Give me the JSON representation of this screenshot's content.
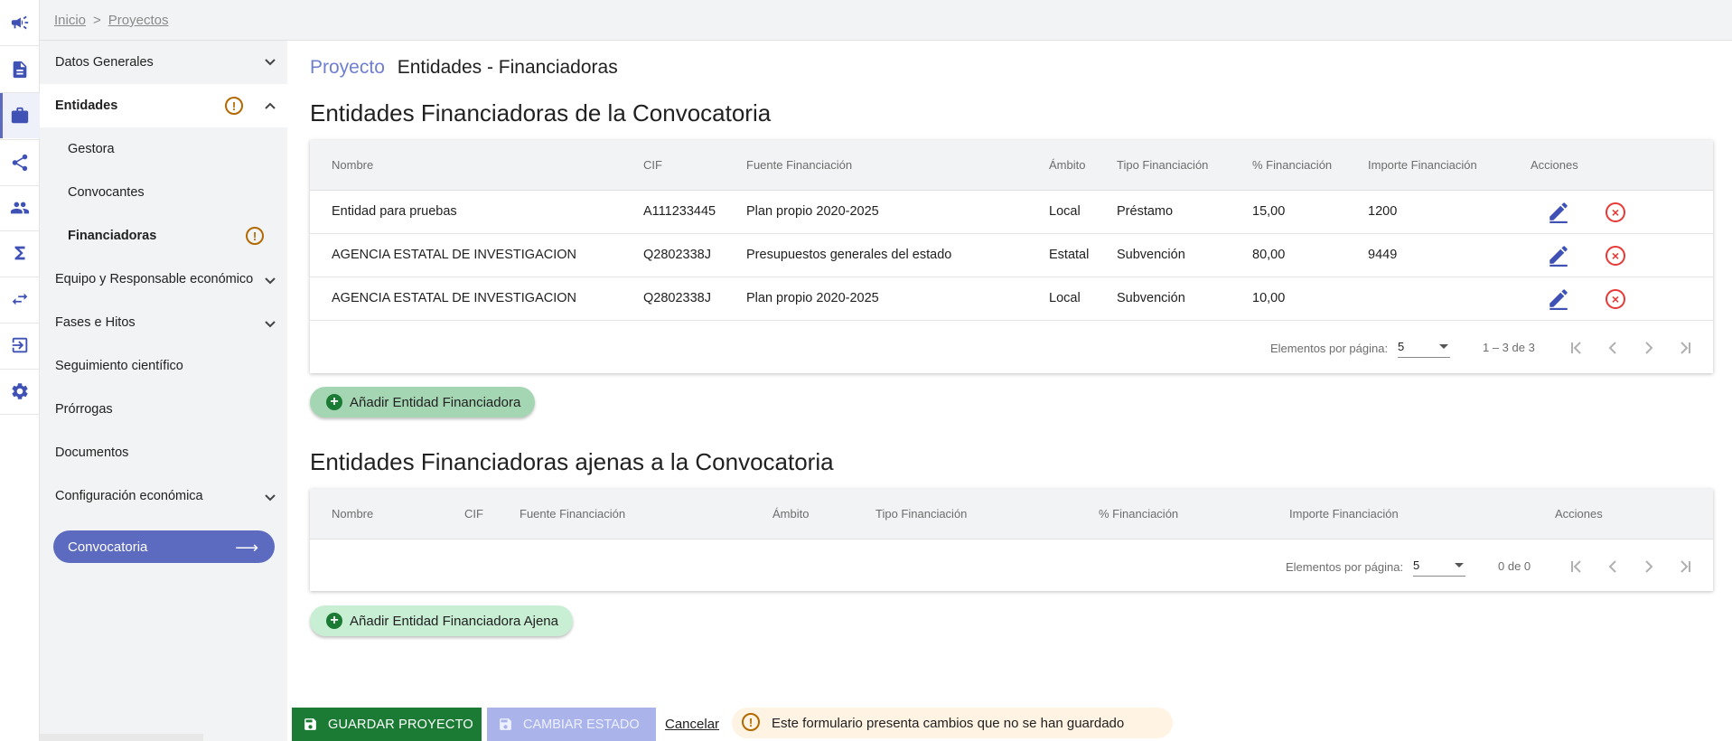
{
  "breadcrumb": {
    "home": "Inicio",
    "separator": ">",
    "current": "Proyectos"
  },
  "rail": {
    "icons": [
      "megaphone-icon",
      "document-icon",
      "briefcase-icon",
      "share-icon",
      "people-icon",
      "sigma-icon",
      "transfer-icon",
      "logout-icon",
      "gear-icon"
    ]
  },
  "sidebar": {
    "items": [
      {
        "label": "Datos Generales"
      },
      {
        "label": "Entidades"
      },
      {
        "label": "Gestora"
      },
      {
        "label": "Convocantes"
      },
      {
        "label": "Financiadoras"
      },
      {
        "label": "Equipo y Responsable económico"
      },
      {
        "label": "Fases e Hitos"
      },
      {
        "label": "Seguimiento científico"
      },
      {
        "label": "Prórrogas"
      },
      {
        "label": "Documentos"
      },
      {
        "label": "Configuración económica"
      }
    ],
    "convocatoria_button": "Convocatoria",
    "convocatoria_arrow": "⟶",
    "warn_glyph": "!"
  },
  "page": {
    "crumb": "Proyecto",
    "title": "Entidades - Financiadoras"
  },
  "section1": {
    "title": "Entidades Financiadoras de la Convocatoria",
    "columns": [
      "Nombre",
      "CIF",
      "Fuente Financiación",
      "Ámbito",
      "Tipo Financiación",
      "% Financiación",
      "Importe Financiación",
      "Acciones"
    ],
    "rows": [
      {
        "nombre": "Entidad para pruebas",
        "cif": "A111233445",
        "fuente": "Plan propio 2020-2025",
        "ambito": "Local",
        "tipo": "Préstamo",
        "porcentaje": "15,00",
        "importe": "1200"
      },
      {
        "nombre": "AGENCIA ESTATAL DE INVESTIGACION",
        "cif": "Q2802338J",
        "fuente": "Presupuestos generales del estado",
        "ambito": "Estatal",
        "tipo": "Subvención",
        "porcentaje": "80,00",
        "importe": "9449"
      },
      {
        "nombre": "AGENCIA ESTATAL DE INVESTIGACION",
        "cif": "Q2802338J",
        "fuente": "Plan propio 2020-2025",
        "ambito": "Local",
        "tipo": "Subvención",
        "porcentaje": "10,00",
        "importe": ""
      }
    ],
    "paginator": {
      "label": "Elementos por página:",
      "page_size": "5",
      "range": "1 – 3 de 3"
    },
    "add_button": "Añadir Entidad Financiadora"
  },
  "section2": {
    "title": "Entidades Financiadoras ajenas a la Convocatoria",
    "columns": [
      "Nombre",
      "CIF",
      "Fuente Financiación",
      "Ámbito",
      "Tipo Financiación",
      "% Financiación",
      "Importe Financiación",
      "Acciones"
    ],
    "rows": [],
    "paginator": {
      "label": "Elementos por página:",
      "page_size": "5",
      "range": "0 de 0"
    },
    "add_button": "Añadir Entidad Financiadora Ajena"
  },
  "bottom": {
    "save": "GUARDAR PROYECTO",
    "change_state": "CAMBIAR ESTADO",
    "cancel": "Cancelar",
    "notice": "Este formulario presenta cambios que no se han guardado"
  },
  "colors": {
    "accent": "#3f51b5",
    "save": "#1b7a34",
    "warn": "#b26a00",
    "delete": "#e53935"
  }
}
